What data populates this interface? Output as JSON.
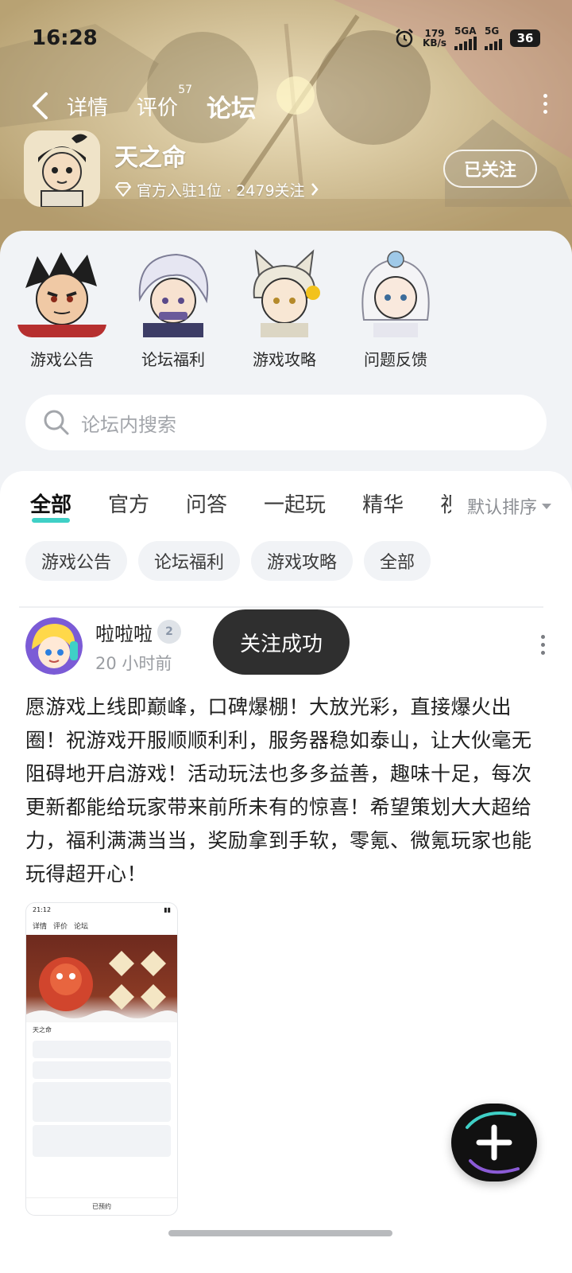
{
  "status_bar": {
    "time": "16:28",
    "speed_value": "179",
    "speed_unit": "KB/s",
    "net1": "5GA",
    "net2": "5G",
    "battery": "36"
  },
  "nav": {
    "tabs": [
      {
        "label": "详情"
      },
      {
        "label": "评价",
        "badge": "57"
      },
      {
        "label": "论坛"
      }
    ]
  },
  "game": {
    "name": "天之命",
    "subtitle": "官方入驻1位 · 2479关注",
    "follow_label": "已关注"
  },
  "shortcuts": [
    {
      "label": "游戏公告"
    },
    {
      "label": "论坛福利"
    },
    {
      "label": "游戏攻略"
    },
    {
      "label": "问题反馈"
    }
  ],
  "search": {
    "placeholder": "论坛内搜索"
  },
  "filter_tabs": [
    {
      "label": "全部"
    },
    {
      "label": "官方"
    },
    {
      "label": "问答"
    },
    {
      "label": "一起玩"
    },
    {
      "label": "精华"
    },
    {
      "label": "视频"
    }
  ],
  "sort_label": "默认排序",
  "chips": [
    {
      "label": "游戏公告"
    },
    {
      "label": "论坛福利"
    },
    {
      "label": "游戏攻略"
    },
    {
      "label": "全部"
    }
  ],
  "post": {
    "author": "啦啦啦",
    "level": "2",
    "time": "20 小时前",
    "text": "愿游戏上线即巅峰，口碑爆棚！大放光彩，直接爆火出圈！祝游戏开服顺顺利利，服务器稳如泰山，让大伙毫无阻碍地开启游戏！活动玩法也多多益善，趣味十足，每次更新都能给玩家带来前所未有的惊喜！希望策划大大超给力，福利满满当当，奖励拿到手软，零氪、微氪玩家也能玩得超开心！",
    "screenshot": {
      "time": "21:12",
      "tabs": [
        "详情",
        "评价",
        "论坛"
      ],
      "game_name": "天之命",
      "bottom_label": "已预约"
    }
  },
  "toast": "关注成功",
  "colors": {
    "accent": "#3fd0c6",
    "toast_bg": "#2f2f2f",
    "panel_bg": "#f1f3f6"
  }
}
